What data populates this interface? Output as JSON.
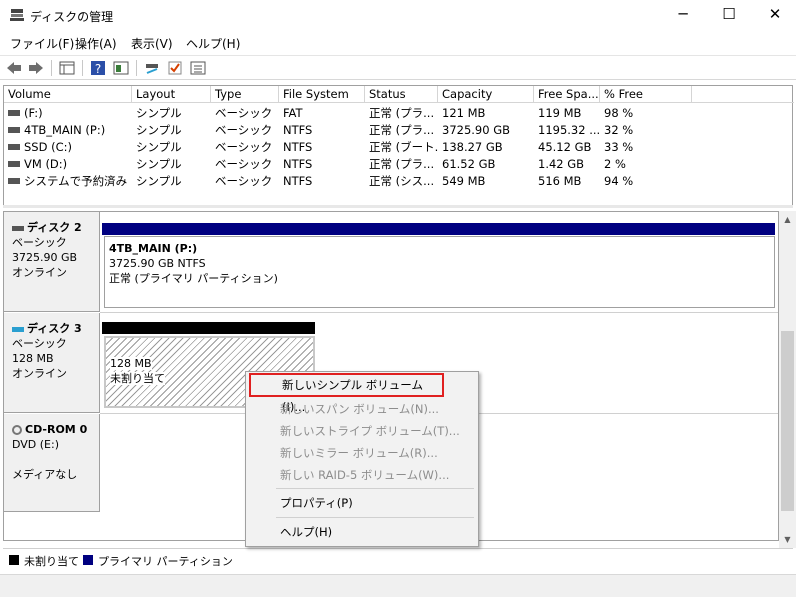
{
  "window": {
    "title": "ディスクの管理",
    "minimize": "─",
    "maximize": "☐",
    "close": "✕"
  },
  "menu": [
    "ファイル(F)",
    "操作(A)",
    "表示(V)",
    "ヘルプ(H)"
  ],
  "volume_table": {
    "columns": [
      "Volume",
      "Layout",
      "Type",
      "File System",
      "Status",
      "Capacity",
      "Free Spa...",
      "% Free"
    ],
    "rows": [
      [
        "(F:)",
        "シンプル",
        "ベーシック",
        "FAT",
        "正常 (プラ...",
        "121 MB",
        "119 MB",
        "98 %"
      ],
      [
        "4TB_MAIN (P:)",
        "シンプル",
        "ベーシック",
        "NTFS",
        "正常 (プラ...",
        "3725.90 GB",
        "1195.32 ...",
        "32 %"
      ],
      [
        "SSD (C:)",
        "シンプル",
        "ベーシック",
        "NTFS",
        "正常 (ブート...",
        "138.27 GB",
        "45.12 GB",
        "33 %"
      ],
      [
        "VM (D:)",
        "シンプル",
        "ベーシック",
        "NTFS",
        "正常 (プラ...",
        "61.52 GB",
        "1.42 GB",
        "2 %"
      ],
      [
        "システムで予約済み",
        "シンプル",
        "ベーシック",
        "NTFS",
        "正常 (シス...",
        "549 MB",
        "516 MB",
        "94 %"
      ]
    ]
  },
  "disks": {
    "disk2": {
      "name": "ディスク 2",
      "type": "ベーシック",
      "size": "3725.90 GB",
      "state": "オンライン",
      "partition": {
        "name": "4TB_MAIN  (P:)",
        "size_fs": "3725.90 GB NTFS",
        "status": "正常 (プライマリ パーティション)"
      }
    },
    "disk3": {
      "name": "ディスク 3",
      "type": "ベーシック",
      "size": "128 MB",
      "state": "オンライン",
      "partition": {
        "size": "128 MB",
        "status": "未割り当て"
      }
    },
    "cdrom": {
      "name": "CD-ROM 0",
      "type": "DVD (E:)",
      "state": "メディアなし"
    }
  },
  "legend": {
    "unallocated": "未割り当て",
    "primary": "プライマリ パーティション",
    "unallocated_color": "#000000",
    "primary_color": "#000080"
  },
  "context_menu": {
    "items": [
      {
        "label": "新しいシンプル ボリューム(I)...",
        "enabled": true
      },
      {
        "label": "新しいスパン ボリューム(N)...",
        "enabled": false
      },
      {
        "label": "新しいストライプ ボリューム(T)...",
        "enabled": false
      },
      {
        "label": "新しいミラー ボリューム(R)...",
        "enabled": false
      },
      {
        "label": "新しい RAID-5 ボリューム(W)...",
        "enabled": false
      },
      {
        "label": "プロパティ(P)",
        "enabled": true
      },
      {
        "label": "ヘルプ(H)",
        "enabled": true
      }
    ]
  },
  "colors": {
    "primary_bar": "#000080",
    "unallocated_bar": "#000000",
    "highlight_outline": "#e02020"
  }
}
